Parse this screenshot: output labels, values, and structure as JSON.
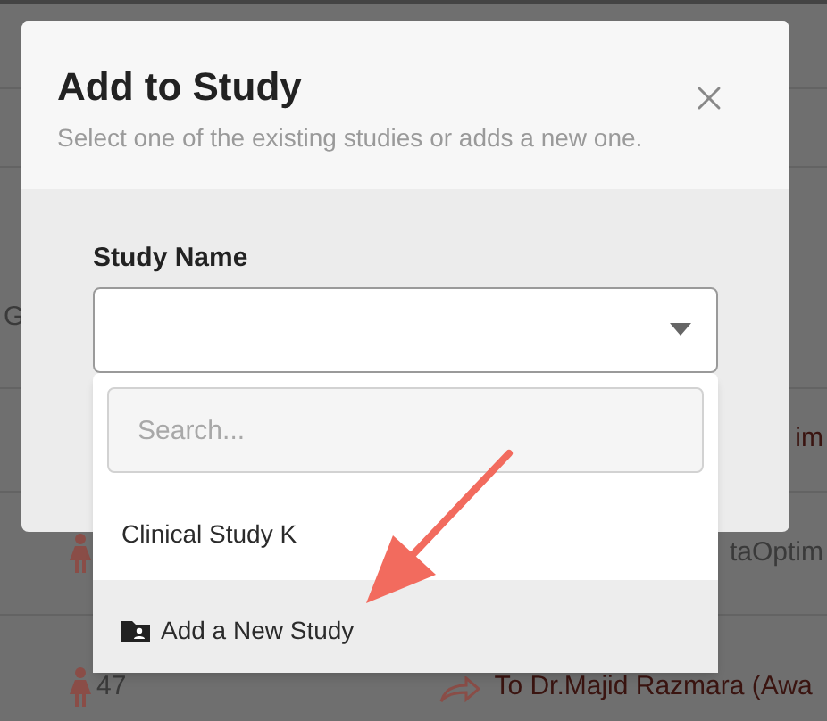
{
  "background": {
    "rows": [
      {
        "kind": "text-left",
        "text": "G"
      },
      {
        "kind": "text-right",
        "text": "im"
      },
      {
        "kind": "patient",
        "text": "taOptim"
      },
      {
        "kind": "patient-referral",
        "count": "47",
        "text": "To Dr.Majid Razmara (Awa"
      }
    ]
  },
  "dialog": {
    "title": "Add to Study",
    "subtitle": "Select one of the existing studies or adds a new one.",
    "field_label": "Study Name",
    "dropdown": {
      "search": {
        "placeholder": "Search..."
      },
      "options": [
        {
          "kind": "option",
          "label": "Clinical Study K",
          "highlighted": false
        },
        {
          "kind": "add",
          "label": "Add a New Study",
          "highlighted": true
        }
      ]
    }
  }
}
